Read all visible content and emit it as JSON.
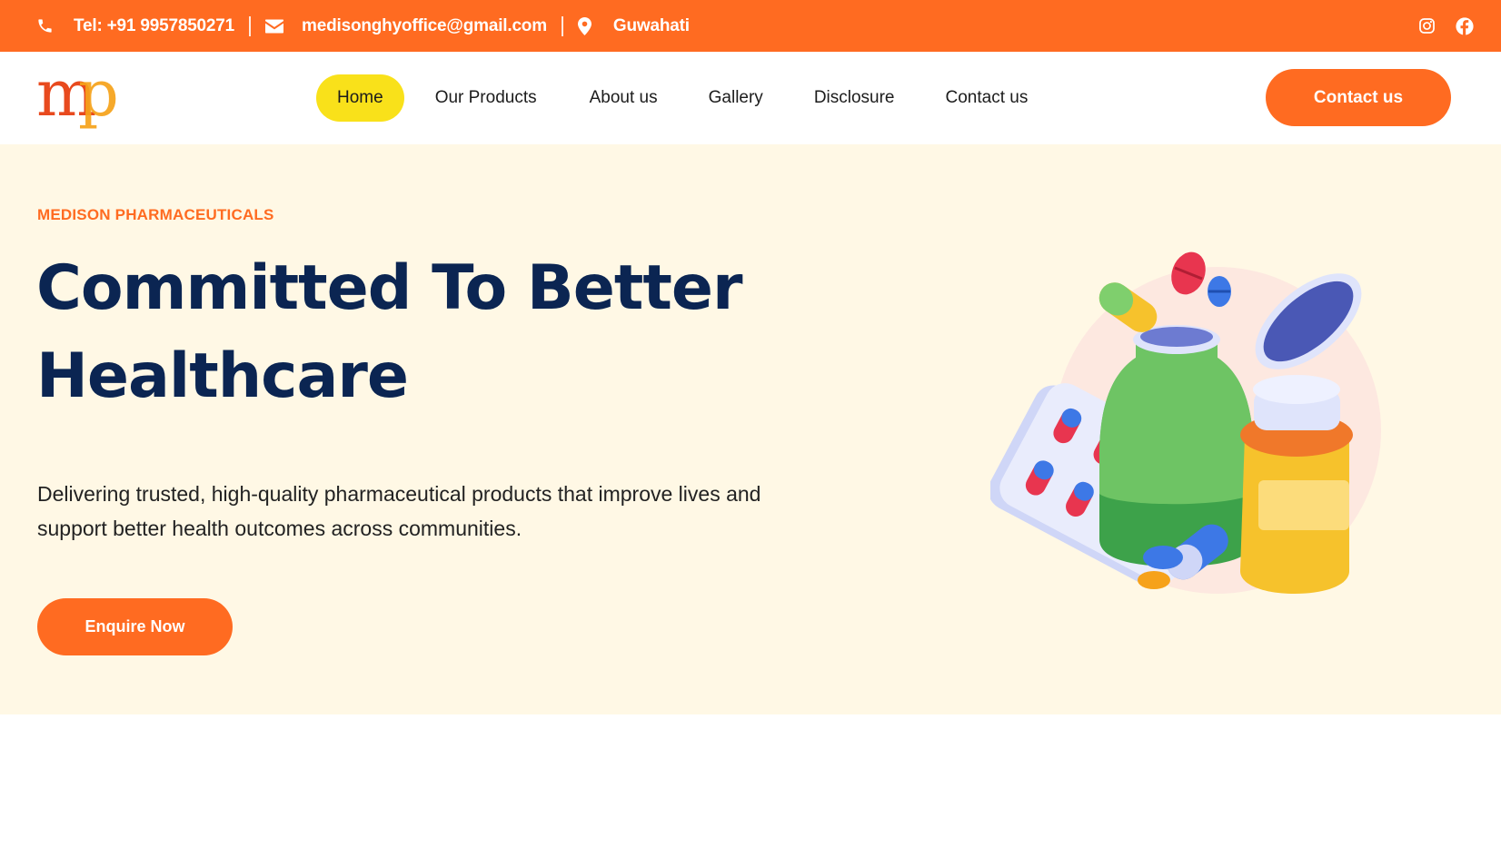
{
  "topbar": {
    "phone": "Tel: +91 9957850271",
    "email": "medisonghyoffice@gmail.com",
    "location": "Guwahati",
    "icons": {
      "phone": "phone-icon",
      "email": "envelope-icon",
      "location": "map-pin-icon",
      "instagram": "instagram-icon",
      "facebook": "facebook-icon"
    }
  },
  "logo": {
    "text": "mp"
  },
  "nav": {
    "items": [
      {
        "label": "Home",
        "active": true
      },
      {
        "label": "Our Products"
      },
      {
        "label": "About us"
      },
      {
        "label": "Gallery"
      },
      {
        "label": "Disclosure"
      },
      {
        "label": "Contact us"
      }
    ],
    "cta_label": "Contact us"
  },
  "hero": {
    "kicker": "MEDISON PHARMACEUTICALS",
    "title_line1": "Committed To Better",
    "title_line2": "Healthcare",
    "description_line1": "Delivering trusted, high-quality pharmaceutical products that improve lives and",
    "description_line2": "support better health outcomes across communities.",
    "button_label": "Enquire Now"
  },
  "colors": {
    "brand_orange": "#ff6b21",
    "highlight_yellow": "#f9e11a",
    "hero_bg": "#fff8e5",
    "title_navy": "#0b2552"
  }
}
